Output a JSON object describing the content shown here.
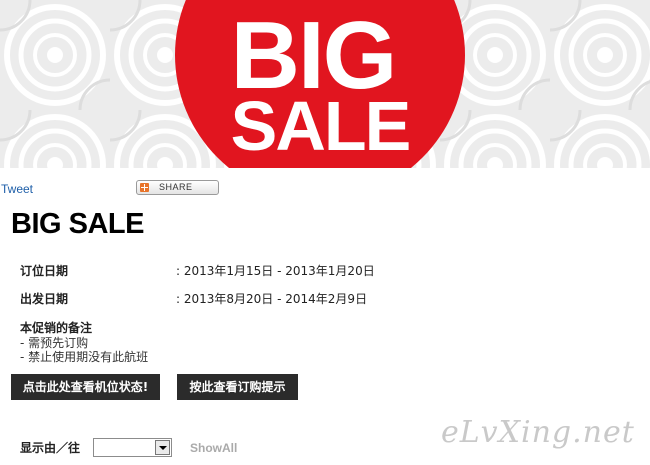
{
  "banner": {
    "line1": "BIG",
    "line2": "SALE"
  },
  "share": {
    "tweet_label": "Tweet",
    "share_label": "SHARE"
  },
  "title": "BIG SALE",
  "booking": {
    "label": "订位日期",
    "value": ": 2013年1月15日 - 2013年1月20日"
  },
  "travel": {
    "label": "出发日期",
    "value": ": 2013年8月20日 - 2014年2月9日"
  },
  "notes": {
    "title": "本促销的备注",
    "items": [
      "- 需预先订购",
      "- 禁止使用期没有此航班"
    ]
  },
  "buttons": {
    "status": "点击此处查看机位状态!",
    "tips": "按此查看订购提示"
  },
  "filter": {
    "label": "显示由／往",
    "select_value": "",
    "show_all": "ShowAll"
  },
  "watermark": "eLvXing.net",
  "colors": {
    "brand_red": "#e1151f",
    "button_bg": "#2b2b2b",
    "link_blue": "#1d5ea8"
  }
}
